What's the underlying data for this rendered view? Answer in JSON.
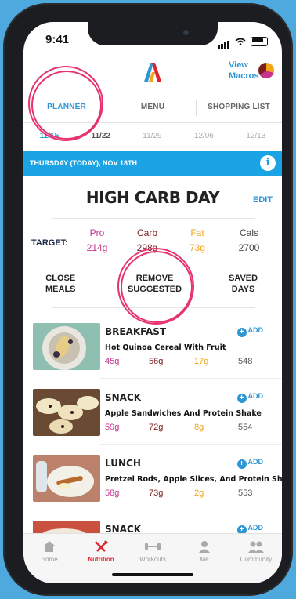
{
  "status": {
    "time": "9:41"
  },
  "header": {
    "view_macros_l1": "View",
    "view_macros_l2": "Macros"
  },
  "tabs": [
    {
      "label": "PLANNER"
    },
    {
      "label": "MENU"
    },
    {
      "label": "SHOPPING LIST"
    }
  ],
  "weeks": [
    "11/15",
    "11/22",
    "11/29",
    "12/06",
    "12/13"
  ],
  "day_banner": "THURSDAY (TODAY), NOV 18TH",
  "day_title": "HIGH CARB DAY",
  "edit_label": "EDIT",
  "targets": {
    "label": "TARGET:",
    "pro": {
      "label": "Pro",
      "value": "214g"
    },
    "carb": {
      "label": "Carb",
      "value": "298g"
    },
    "fat": {
      "label": "Fat",
      "value": "73g"
    },
    "cals": {
      "label": "Cals",
      "value": "2700"
    }
  },
  "actions": {
    "close_l1": "CLOSE",
    "close_l2": "MEALS",
    "remove_l1": "REMOVE",
    "remove_l2": "SUGGESTED",
    "saved_l1": "SAVED",
    "saved_l2": "DAYS"
  },
  "add_label": "ADD",
  "meals": [
    {
      "type": "BREAKFAST",
      "desc": "Hot Quinoa Cereal With Fruit",
      "pro": "45g",
      "carb": "56g",
      "fat": "17g",
      "cals": "548"
    },
    {
      "type": "SNACK",
      "desc": "Apple Sandwiches And Protein Shake",
      "pro": "59g",
      "carb": "72g",
      "fat": "8g",
      "cals": "554"
    },
    {
      "type": "LUNCH",
      "desc": "Pretzel Rods, Apple Slices, And Protein Shake",
      "pro": "58g",
      "carb": "73g",
      "fat": "2g",
      "cals": "553"
    },
    {
      "type": "SNACK",
      "desc": "",
      "pro": "",
      "carb": "",
      "fat": "",
      "cals": ""
    }
  ],
  "tabbar": [
    {
      "label": "Home",
      "icon": "home-icon"
    },
    {
      "label": "Nutrition",
      "icon": "fork-knife-icon"
    },
    {
      "label": "Workouts",
      "icon": "dumbbell-icon"
    },
    {
      "label": "Me",
      "icon": "person-icon"
    },
    {
      "label": "Community",
      "icon": "people-icon"
    }
  ],
  "colors": {
    "accent": "#2f95d4",
    "banner": "#1aa4e4",
    "pro": "#c5318c",
    "carb": "#7b1e1e",
    "fat": "#f2a516",
    "active_tab": "#e0232e",
    "highlight_circle": "#e6336f"
  }
}
